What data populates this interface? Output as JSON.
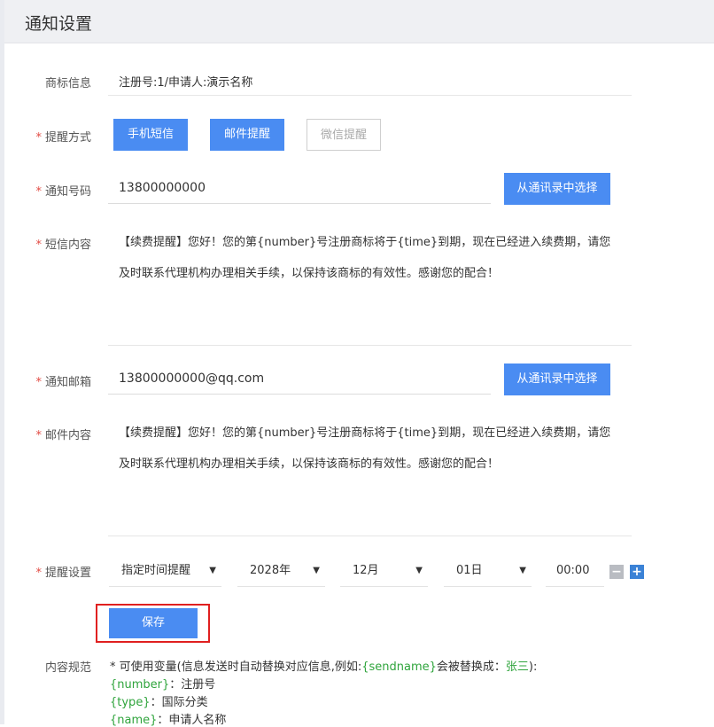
{
  "page": {
    "title": "通知设置"
  },
  "trademark": {
    "label": "商标信息",
    "value": "注册号:1/申请人:演示名称"
  },
  "method": {
    "label": "提醒方式",
    "sms": "手机短信",
    "email": "邮件提醒",
    "wechat": "微信提醒"
  },
  "phone": {
    "label": "通知号码",
    "value": "13800000000",
    "select_button": "从通讯录中选择"
  },
  "sms_content": {
    "label": "短信内容",
    "line1": "【续费提醒】您好！您的第{number}号注册商标将于{time}到期，现在已经进入续费期，请您",
    "line2": "及时联系代理机构办理相关手续，以保持该商标的有效性。感谢您的配合！"
  },
  "mail": {
    "label": "通知邮箱",
    "value": "13800000000@qq.com",
    "select_button": "从通讯录中选择"
  },
  "mail_content": {
    "label": "邮件内容",
    "line1": "【续费提醒】您好！您的第{number}号注册商标将于{time}到期，现在已经进入续费期，请您",
    "line2": "及时联系代理机构办理相关手续，以保持该商标的有效性。感谢您的配合！"
  },
  "remind": {
    "label": "提醒设置",
    "mode": "指定时间提醒",
    "year": "2028年",
    "month": "12月",
    "day": "01日",
    "time": "00:00",
    "caret": "▼",
    "minus": "−",
    "plus": "+"
  },
  "save": {
    "label": "保存"
  },
  "spec": {
    "label": "内容规范",
    "intro_prefix": "* 可使用变量(信息发送时自动替换对应信息,例如:",
    "intro_var": "{sendname}",
    "intro_mid": "会被替换成：",
    "intro_example": "张三",
    "intro_suffix": "):",
    "vars": [
      {
        "name": "{number}",
        "desc": "：注册号"
      },
      {
        "name": "{type}",
        "desc": "：国际分类"
      },
      {
        "name": "{name}",
        "desc": "：申请人名称"
      }
    ]
  },
  "required_star": "*",
  "colors": {
    "primary": "#4a8cf2",
    "required": "#e24a43",
    "variable": "#2fa43c",
    "highlight_border": "#e02020"
  }
}
